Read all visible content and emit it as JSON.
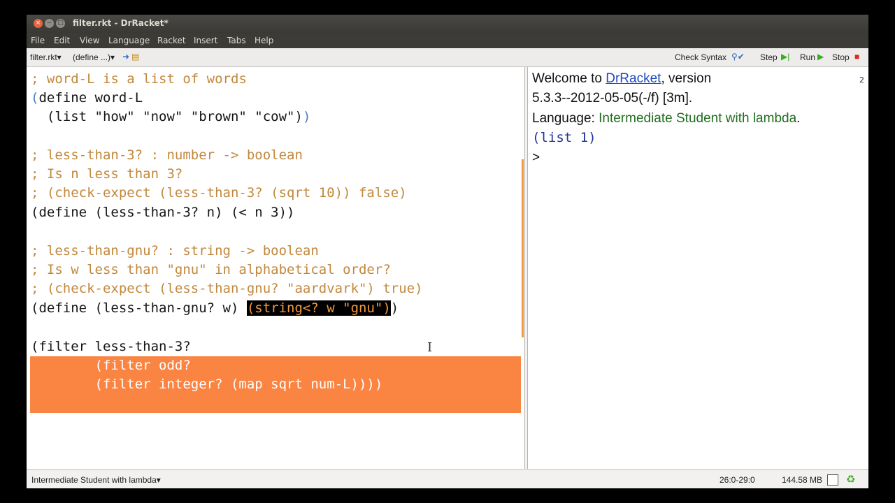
{
  "window": {
    "title": "filter.rkt - DrRacket*",
    "controls": {
      "close": "×",
      "minimize": "−",
      "maximize": "□"
    }
  },
  "menu": [
    "File",
    "Edit",
    "View",
    "Language",
    "Racket",
    "Insert",
    "Tabs",
    "Help"
  ],
  "toolbar": {
    "file_selector": "filter.rkt▾",
    "define_selector": "(define ...)▾",
    "save_icon": "save-icon",
    "check_syntax": "Check Syntax",
    "step": "Step",
    "run": "Run",
    "stop": "Stop",
    "icons": {
      "check_syntax": "magnifier-check-icon",
      "step": "step-icon",
      "run": "run-icon",
      "stop": "stop-icon"
    },
    "colors": {
      "run": "#3cad22",
      "stop": "#e0281c",
      "check": "#2f6bbf"
    }
  },
  "editor": {
    "lines": {
      "l1": "; word-L is a list of words",
      "l2_paren": "(",
      "l2_rest": "define word-L",
      "l3": "  (list \"how\" \"now\" \"brown\" \"cow\")",
      "l3_close": ")",
      "l5": "; less-than-3? : number -> boolean",
      "l6": "; Is n less than 3?",
      "l7": "; (check-expect (less-than-3? (sqrt 10)) false)",
      "l8": "(define (less-than-3? n) (< n 3))",
      "l10": "; less-than-gnu? : string -> boolean",
      "l11": "; Is w less than \"gnu\" in alphabetical order?",
      "l12": "; (check-expect (less-than-gnu? \"aardvark\") true)",
      "l13_start": "(define (less-than-gnu? w) ",
      "l13_selected": "(string<? w \"gnu\")",
      "l13_end": ")",
      "l15": "(filter less-than-3?",
      "l16": "        (filter odd?",
      "l17": "        (filter integer? (map sqrt num-L))))"
    },
    "colors": {
      "comment": "#c2883d",
      "paren": "#4a7fc0",
      "error_highlight": "#fa8543",
      "selection": "#000000"
    }
  },
  "repl": {
    "welcome_prefix": "Welcome to ",
    "welcome_link": "DrRacket",
    "welcome_suffix": ", version",
    "version": "5.3.3--2012-05-05(-/f) [3m].",
    "language_prefix": "Language: ",
    "language_name": "Intermediate Student with lambda",
    "language_suffix": ".",
    "result": "(list 1)",
    "prompt": ">",
    "corner_icon": "2"
  },
  "status": {
    "language": "Intermediate Student with lambda▾",
    "position": "26:0-29:0",
    "memory": "144.58 MB",
    "gc_icon": "recycle-icon"
  }
}
